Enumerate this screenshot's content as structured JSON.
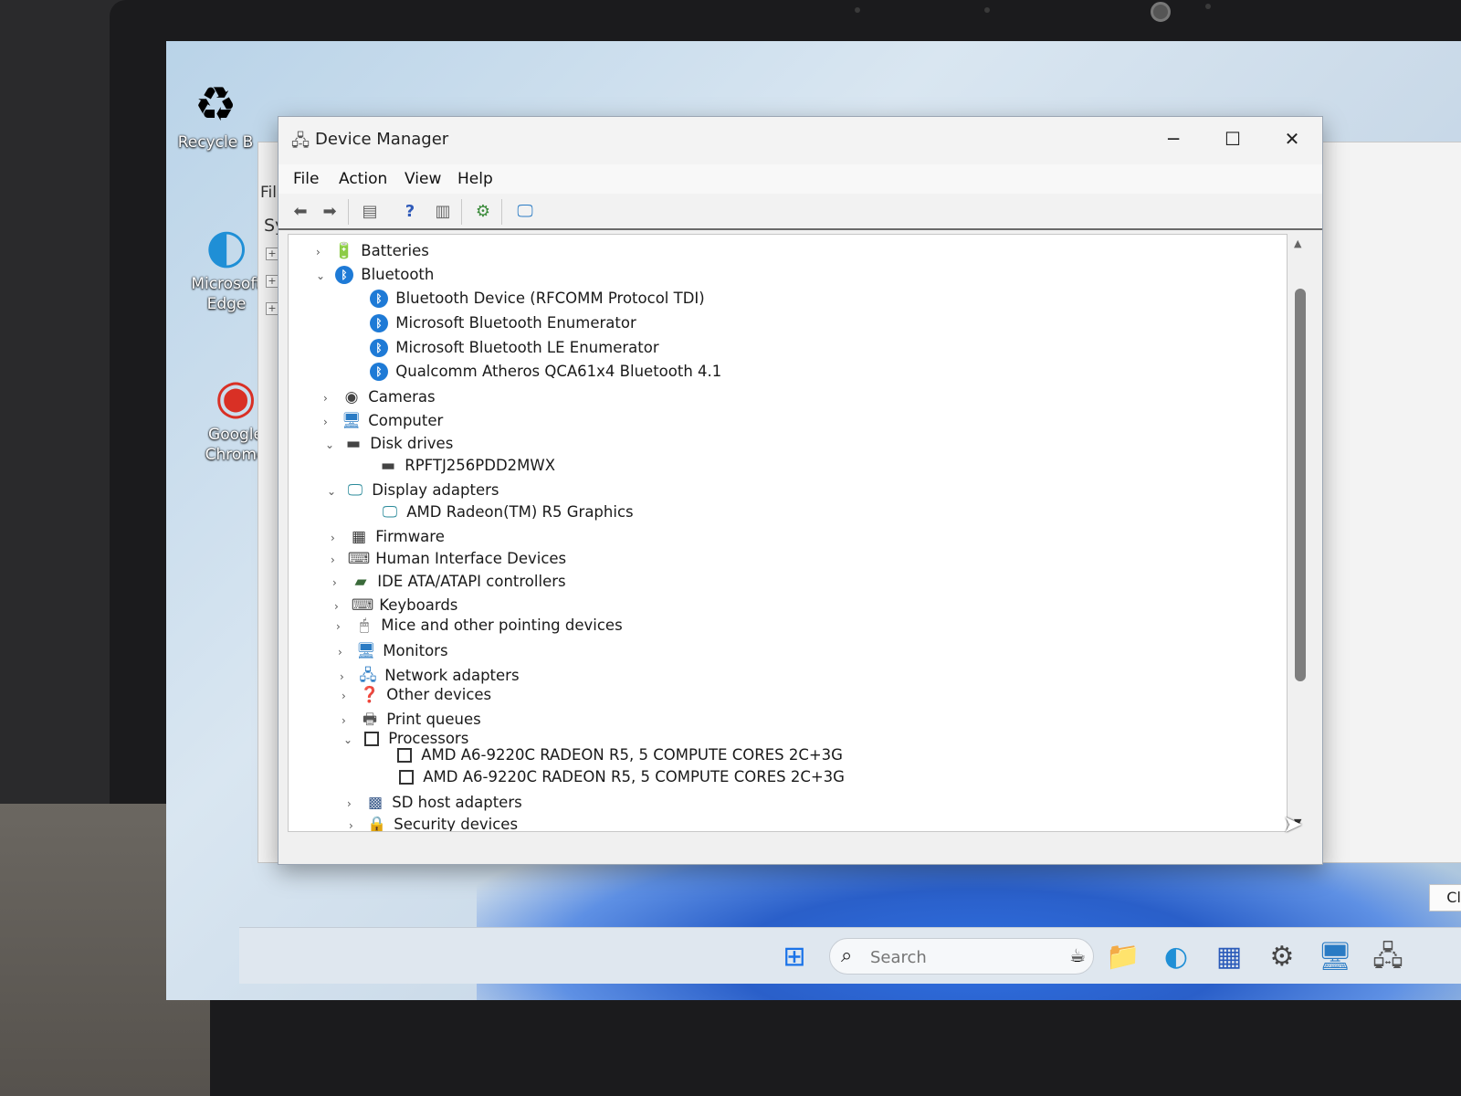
{
  "desktop": {
    "icons": [
      {
        "label": "Recycle B",
        "icon": "recycle-bin-icon"
      },
      {
        "label": "Microsoft Edge",
        "icon": "edge-icon"
      },
      {
        "label": "Google Chrome",
        "icon": "chrome-icon"
      }
    ]
  },
  "background_window": {
    "file_menu": "Fil",
    "sidebar_label": "Sy",
    "close_find_label": "Close Find"
  },
  "window": {
    "title": "Device Manager",
    "controls": {
      "minimize": "─",
      "maximize": "☐",
      "close": "✕"
    }
  },
  "menu": {
    "items": [
      "File",
      "Action",
      "View",
      "Help"
    ]
  },
  "toolbar": {
    "buttons": [
      "back-icon",
      "forward-icon",
      "properties-icon",
      "help-icon",
      "show-hide-console-tree-icon",
      "update-driver-icon",
      "scan-hardware-icon"
    ]
  },
  "tree": {
    "rows": [
      {
        "label": "Batteries",
        "level": 0,
        "expanded": false,
        "icon": "battery-icon"
      },
      {
        "label": "Bluetooth",
        "level": 0,
        "expanded": true,
        "icon": "bluetooth-icon"
      },
      {
        "label": "Bluetooth Device (RFCOMM Protocol TDI)",
        "level": 1,
        "icon": "bluetooth-icon"
      },
      {
        "label": "Microsoft Bluetooth Enumerator",
        "level": 1,
        "icon": "bluetooth-icon"
      },
      {
        "label": "Microsoft Bluetooth LE Enumerator",
        "level": 1,
        "icon": "bluetooth-icon"
      },
      {
        "label": "Qualcomm Atheros QCA61x4 Bluetooth 4.1",
        "level": 1,
        "icon": "bluetooth-icon"
      },
      {
        "label": "Cameras",
        "level": 0,
        "expanded": false,
        "icon": "camera-icon"
      },
      {
        "label": "Computer",
        "level": 0,
        "expanded": false,
        "icon": "computer-icon"
      },
      {
        "label": "Disk drives",
        "level": 0,
        "expanded": true,
        "icon": "disk-drive-icon"
      },
      {
        "label": "RPFTJ256PDD2MWX",
        "level": 1,
        "icon": "disk-drive-icon"
      },
      {
        "label": "Display adapters",
        "level": 0,
        "expanded": true,
        "icon": "display-adapter-icon"
      },
      {
        "label": "AMD Radeon(TM) R5 Graphics",
        "level": 1,
        "icon": "display-adapter-icon"
      },
      {
        "label": "Firmware",
        "level": 0,
        "expanded": false,
        "icon": "firmware-icon"
      },
      {
        "label": "Human Interface Devices",
        "level": 0,
        "expanded": false,
        "icon": "hid-icon"
      },
      {
        "label": "IDE ATA/ATAPI controllers",
        "level": 0,
        "expanded": false,
        "icon": "ide-controller-icon"
      },
      {
        "label": "Keyboards",
        "level": 0,
        "expanded": false,
        "icon": "keyboard-icon"
      },
      {
        "label": "Mice and other pointing devices",
        "level": 0,
        "expanded": false,
        "icon": "mouse-icon"
      },
      {
        "label": "Monitors",
        "level": 0,
        "expanded": false,
        "icon": "monitor-icon"
      },
      {
        "label": "Network adapters",
        "level": 0,
        "expanded": false,
        "icon": "network-adapter-icon"
      },
      {
        "label": "Other devices",
        "level": 0,
        "expanded": false,
        "icon": "other-devices-icon"
      },
      {
        "label": "Print queues",
        "level": 0,
        "expanded": false,
        "icon": "printer-icon"
      },
      {
        "label": "Processors",
        "level": 0,
        "expanded": true,
        "icon": "processor-icon"
      },
      {
        "label": "AMD A6-9220C RADEON R5, 5 COMPUTE CORES 2C+3G",
        "level": 1,
        "icon": "processor-icon"
      },
      {
        "label": "AMD A6-9220C RADEON R5, 5 COMPUTE CORES 2C+3G",
        "level": 1,
        "icon": "processor-icon"
      },
      {
        "label": "SD host adapters",
        "level": 0,
        "expanded": false,
        "icon": "sd-host-icon"
      },
      {
        "label": "Security devices",
        "level": 0,
        "expanded": false,
        "icon": "security-device-icon"
      }
    ]
  },
  "taskbar": {
    "search_placeholder": "Search",
    "icons": [
      "start-icon",
      "search-icon",
      "file-explorer-icon",
      "edge-icon",
      "store-icon",
      "settings-icon",
      "remote-desktop-icon",
      "device-manager-icon"
    ]
  }
}
